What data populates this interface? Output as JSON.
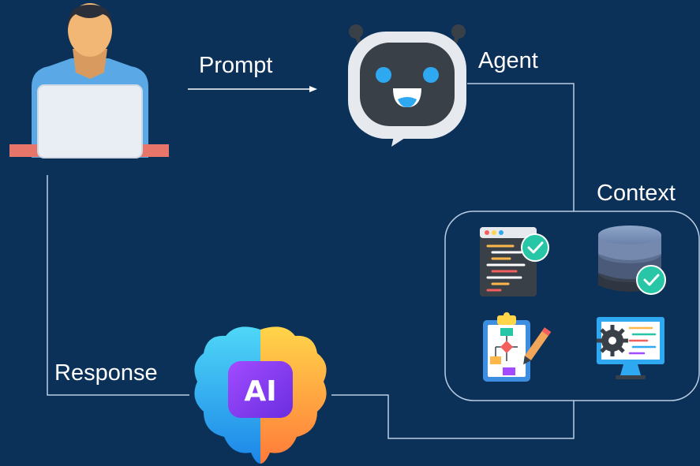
{
  "labels": {
    "prompt": "Prompt",
    "agent": "Agent",
    "context": "Context",
    "response": "Response",
    "ai_badge": "AI"
  },
  "colors": {
    "background": "#0b3158",
    "connector": "#b9cde3",
    "arrow": "#ffffff"
  },
  "icons": {
    "user": "person-at-laptop-icon",
    "agent": "robot-chat-bubble-icon",
    "context_items": [
      "code-editor-check-icon",
      "database-check-icon",
      "clipboard-flowchart-icon",
      "monitor-settings-icon"
    ],
    "response": "ai-brain-icon"
  }
}
